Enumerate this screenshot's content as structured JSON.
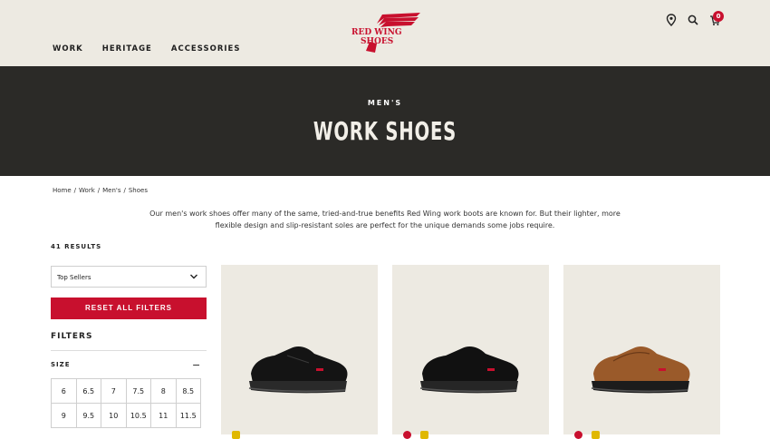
{
  "header": {
    "logo_text_1": "RED WING",
    "logo_text_2": "SHOES",
    "nav": [
      "WORK",
      "HERITAGE",
      "ACCESSORIES"
    ],
    "icons": [
      "location-pin-icon",
      "search-icon",
      "cart-icon"
    ],
    "cart_count": "0",
    "brand_color": "#c8102e"
  },
  "hero": {
    "eyebrow": "MEN'S",
    "title": "WORK SHOES"
  },
  "breadcrumb": [
    "Home",
    "/",
    "Work",
    "/",
    "Men's",
    "/",
    "Shoes"
  ],
  "intro": "Our men's work shoes offer many of the same, tried-and-true benefits Red Wing work boots are known for. But their lighter, more flexible design and slip-resistant soles are perfect for the unique demands some jobs require.",
  "results": "41 RESULTS",
  "sort": {
    "selected": "Top Sellers"
  },
  "reset_label": "RESET ALL FILTERS",
  "filters": {
    "heading": "FILTERS",
    "size": {
      "label": "SIZE",
      "toggle": "−",
      "options": [
        "6",
        "6.5",
        "7",
        "7.5",
        "8",
        "8.5",
        "9",
        "9.5",
        "10",
        "10.5",
        "11",
        "11.5"
      ]
    }
  },
  "products": [
    {
      "color": "black"
    },
    {
      "color": "black"
    },
    {
      "color": "brown"
    }
  ]
}
